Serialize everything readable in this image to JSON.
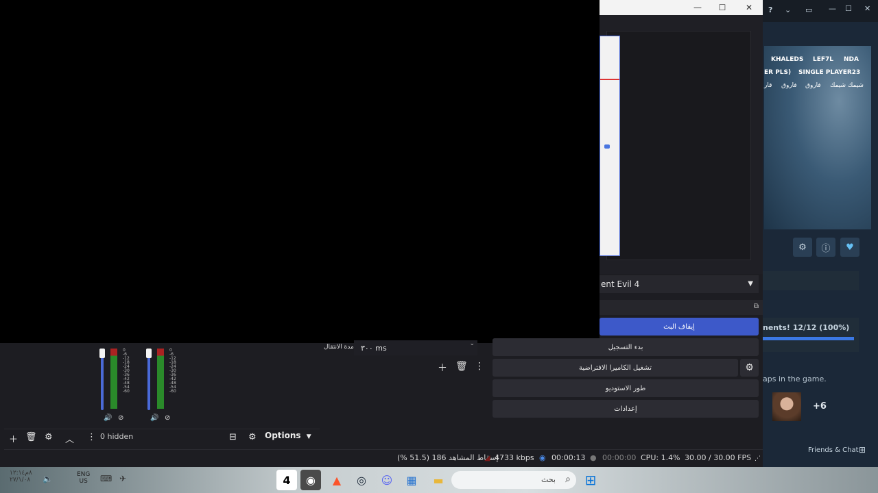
{
  "window": {
    "minimize": "—",
    "maximize": "☐",
    "close": "✕"
  },
  "scene_select": {
    "value": "ent Evil 4"
  },
  "controls": {
    "stop_stream": "إيقاف البث",
    "start_recording": "بدء التسجيل",
    "start_virtual_camera": "تشغيل الكاميرا الافتراضية",
    "studio_mode": "طور الاستوديو",
    "settings": "إعدادات"
  },
  "transitions": {
    "duration_label": "مدة الانتقال",
    "duration_value": "٣٠٠ ms"
  },
  "mixer": {
    "scale": [
      "0",
      "-6",
      "-12",
      "-18",
      "-24",
      "-30",
      "-36",
      "-42",
      "-48",
      "-54",
      "-60"
    ]
  },
  "sources_toolbar": {
    "hidden": "0 hidden",
    "options": "Options"
  },
  "status": {
    "dropped_frames": "إسقاط المشاهد 186 (51.5 %)",
    "bitrate": "4733 kbps",
    "stream_time": "00:00:13",
    "rec_time": "00:00:00",
    "cpu": "CPU: 1.4%",
    "fps": "30.00 / 30.00 FPS"
  },
  "steam": {
    "tags_row1": [
      "KHALEDS",
      "LEF7L",
      "NDA"
    ],
    "tags_row2": [
      "ER PLS)",
      "SINGLE PLAYER23"
    ],
    "tags_row3": [
      "قار",
      "فاروق",
      "فاروق",
      "شيمك شيمك"
    ],
    "achievements": "nents! 12/12 (100%)",
    "achievements_progress": 1.0,
    "caps_text": "aps in the game.",
    "friends_more": "+6",
    "friends_chat": "Friends & Chat"
  },
  "taskbar": {
    "sys_left": [
      "٨م١٢:١٤",
      "٢٧/١/٠٨"
    ],
    "lang": [
      "ENG",
      "US"
    ],
    "search_placeholder": "بحث"
  }
}
